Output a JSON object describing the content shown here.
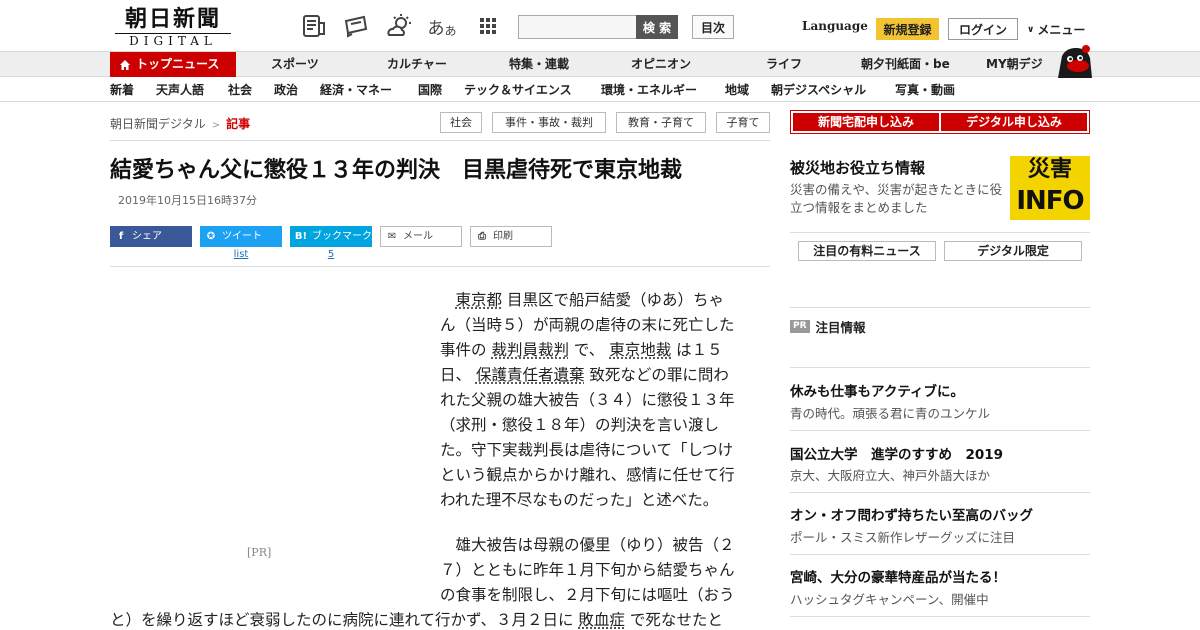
{
  "header": {
    "logo_kanji": "朝日新聞",
    "logo_latin": "DIGITAL",
    "aa_big": "あ",
    "aa_small": "あ",
    "search_placeholder": "",
    "search_label": "検 索",
    "toc_label": "目次",
    "language_label": "Language",
    "register_label": "新規登録",
    "login_label": "ログイン",
    "menu_label": "メニュー"
  },
  "nav_primary": [
    "トップニュース",
    "スポーツ",
    "カルチャー",
    "特集・連載",
    "オピニオン",
    "ライフ",
    "朝夕刊紙面・be",
    "MY朝デジ"
  ],
  "nav_secondary": [
    "新着",
    "天声人語",
    "社会",
    "政治",
    "経済・マネー",
    "国際",
    "テック＆サイエンス",
    "環境・エネルギー",
    "地域",
    "朝デジスペシャル",
    "写真・動画"
  ],
  "breadcrumb": {
    "home": "朝日新聞デジタル",
    "sep": ">",
    "current": "記事"
  },
  "tags": [
    "社会",
    "事件・事故・裁判",
    "教育・子育て",
    "子育て"
  ],
  "article": {
    "title": "結愛ちゃん父に懲役１３年の判決　目黒虐待死で東京地裁",
    "date": "2019年10月15日16時37分",
    "share": {
      "facebook": "シェア",
      "twitter": "ツイート",
      "twitter_count": "list",
      "hatena": "ブックマーク",
      "hatena_count": "5",
      "mail": "メール",
      "print": "印刷"
    },
    "pr_label": "[PR]",
    "p1": {
      "l1_link1": "東京都",
      "l1_rest": " 目黒区で船戸結愛（ゆあ）ちゃ",
      "l2": "ん（当時５）が両親の虐待の末に死亡した",
      "l3_pre": "事件の ",
      "l3_link": "裁判員裁判",
      "l3_mid": " で、 ",
      "l3_link2": "東京地裁",
      "l3_post": " は１５",
      "l4_pre": "日、 ",
      "l4_link": "保護責任者遺棄",
      "l4_post": " 致死などの罪に問わ",
      "l5": "れた父親の雄大被告（３４）に懲役１３年",
      "l6": "（求刑・懲役１８年）の判決を言い渡し",
      "l7": "た。守下実裁判長は虐待について「しつけ",
      "l8": "という観点からかけ離れ、感情に任せて行",
      "l9": "われた理不尽なものだった」と述べた。"
    },
    "p2": {
      "l1": "雄大被告は母親の優里（ゆり）被告（２",
      "l2": "７）とともに昨年１月下旬から結愛ちゃん",
      "l3": "の食事を制限し、２月下旬には嘔吐（おう",
      "l4_pre": "と）を繰り返すほど衰弱したのに病院に連れて行かず、３月２日に ",
      "l4_link": "敗血症",
      "l4_post": " で死なせたと"
    }
  },
  "sidebar": {
    "sub_home": "新聞宅配申し込み",
    "sub_digital": "デジタル申し込み",
    "disaster_title": "被災地お役立ち情報",
    "disaster_desc": "災害の備えや、災害が起きたときに役立つ情報をまとめました",
    "disaster_badge_kanji": "災害",
    "disaster_badge_en": "INFO",
    "tab_paid": "注目の有料ニュース",
    "tab_digital": "デジタル限定",
    "pr_badge": "PR",
    "pr_heading": "注目情報",
    "ads": [
      {
        "title": "休みも仕事もアクティブに。",
        "sub": "青の時代。頑張る君に青のユンケル"
      },
      {
        "title": "国公立大学　進学のすすめ　2019",
        "sub": "京大、大阪府立大、神戸外語大ほか"
      },
      {
        "title": "オン・オフ問わず持ちたい至高のバッグ",
        "sub": "ポール・スミス新作レザーグッズに注目"
      },
      {
        "title": "宮崎、大分の豪華特産品が当たる！",
        "sub": "ハッシュタグキャンペーン、開催中"
      }
    ]
  },
  "colors": {
    "accent": "#cc0000",
    "register": "#f3c432",
    "disaster": "#f3d400",
    "facebook": "#3b5998",
    "twitter": "#1da1f2",
    "hatena": "#00a4de"
  }
}
